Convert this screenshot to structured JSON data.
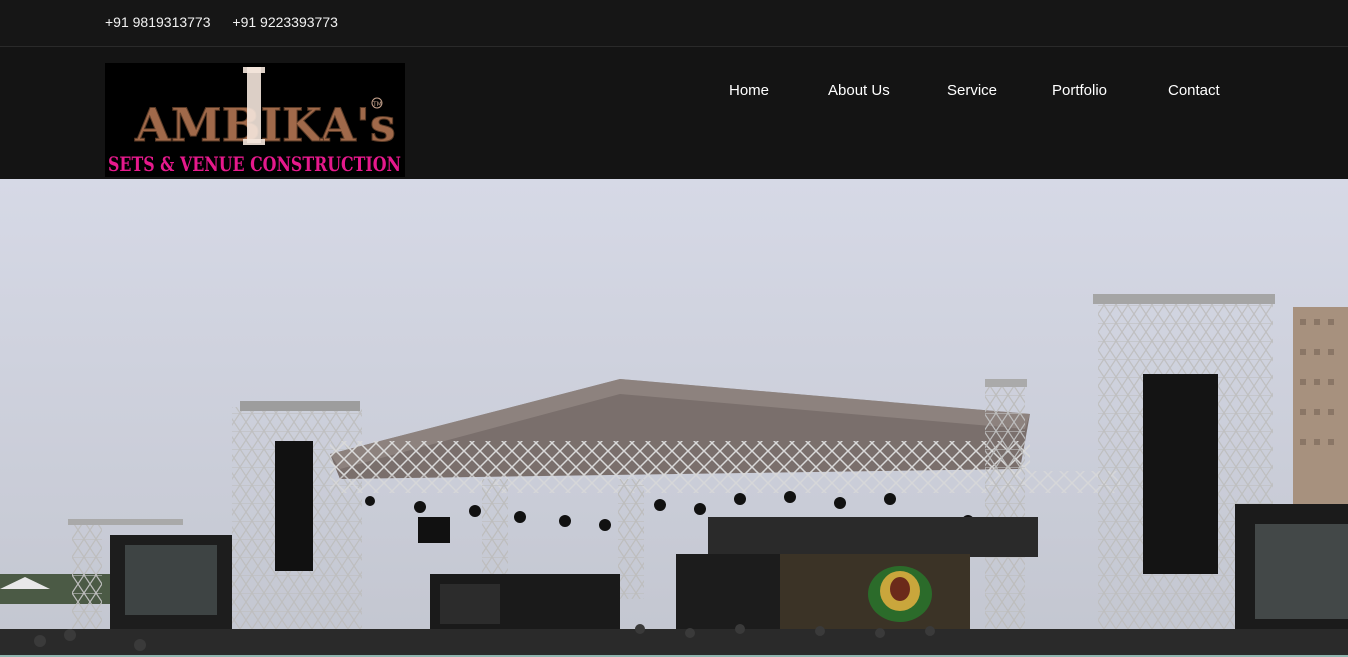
{
  "topbar": {
    "phones": [
      "+91 9819313773",
      "+91 9223393773"
    ]
  },
  "logo": {
    "brand": "AMBIKA's",
    "tagline": "SETS & VENUE CONSTRUCTION",
    "mark": "TM"
  },
  "nav": {
    "items": [
      {
        "label": "Home"
      },
      {
        "label": "About Us"
      },
      {
        "label": "Service"
      },
      {
        "label": "Portfolio"
      },
      {
        "label": "Contact"
      }
    ]
  },
  "hero": {
    "image_subject": "outdoor concert stage with truss structure and speaker towers"
  },
  "colors": {
    "background": "#141414",
    "brand_copper": "#a0694a",
    "tagline_pink": "#e6198c"
  }
}
